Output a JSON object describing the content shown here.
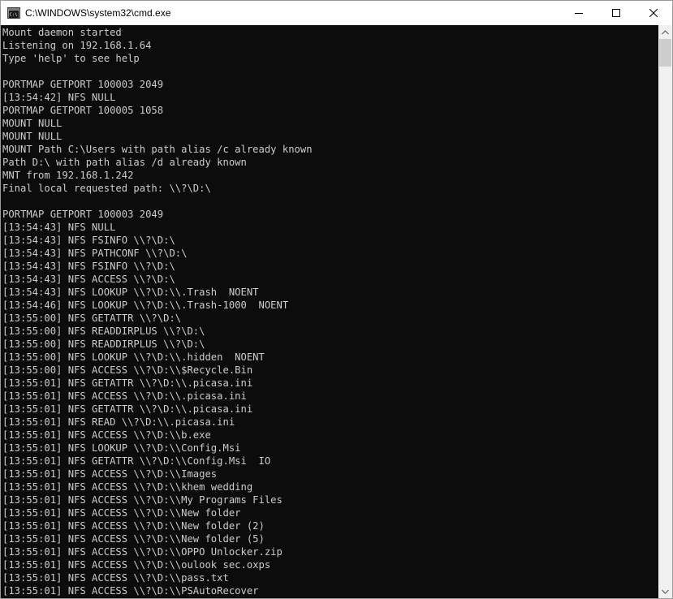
{
  "window": {
    "title": "C:\\WINDOWS\\system32\\cmd.exe"
  },
  "console": {
    "lines": [
      "Mount daemon started",
      "Listening on 192.168.1.64",
      "Type 'help' to see help",
      "",
      "PORTMAP GETPORT 100003 2049",
      "[13:54:42] NFS NULL",
      "PORTMAP GETPORT 100005 1058",
      "MOUNT NULL",
      "MOUNT NULL",
      "MOUNT Path C:\\Users with path alias /c already known",
      "Path D:\\ with path alias /d already known",
      "MNT from 192.168.1.242",
      "Final local requested path: \\\\?\\D:\\",
      "",
      "PORTMAP GETPORT 100003 2049",
      "[13:54:43] NFS NULL",
      "[13:54:43] NFS FSINFO \\\\?\\D:\\",
      "[13:54:43] NFS PATHCONF \\\\?\\D:\\",
      "[13:54:43] NFS FSINFO \\\\?\\D:\\",
      "[13:54:43] NFS ACCESS \\\\?\\D:\\",
      "[13:54:43] NFS LOOKUP \\\\?\\D:\\\\.Trash  NOENT",
      "[13:54:46] NFS LOOKUP \\\\?\\D:\\\\.Trash-1000  NOENT",
      "[13:55:00] NFS GETATTR \\\\?\\D:\\",
      "[13:55:00] NFS READDIRPLUS \\\\?\\D:\\",
      "[13:55:00] NFS READDIRPLUS \\\\?\\D:\\",
      "[13:55:00] NFS LOOKUP \\\\?\\D:\\\\.hidden  NOENT",
      "[13:55:00] NFS ACCESS \\\\?\\D:\\\\$Recycle.Bin",
      "[13:55:01] NFS GETATTR \\\\?\\D:\\\\.picasa.ini",
      "[13:55:01] NFS ACCESS \\\\?\\D:\\\\.picasa.ini",
      "[13:55:01] NFS GETATTR \\\\?\\D:\\\\.picasa.ini",
      "[13:55:01] NFS READ \\\\?\\D:\\\\.picasa.ini",
      "[13:55:01] NFS ACCESS \\\\?\\D:\\\\b.exe",
      "[13:55:01] NFS LOOKUP \\\\?\\D:\\\\Config.Msi",
      "[13:55:01] NFS GETATTR \\\\?\\D:\\\\Config.Msi  IO",
      "[13:55:01] NFS ACCESS \\\\?\\D:\\\\Images",
      "[13:55:01] NFS ACCESS \\\\?\\D:\\\\khem wedding",
      "[13:55:01] NFS ACCESS \\\\?\\D:\\\\My Programs Files",
      "[13:55:01] NFS ACCESS \\\\?\\D:\\\\New folder",
      "[13:55:01] NFS ACCESS \\\\?\\D:\\\\New folder (2)",
      "[13:55:01] NFS ACCESS \\\\?\\D:\\\\New folder (5)",
      "[13:55:01] NFS ACCESS \\\\?\\D:\\\\OPPO Unlocker.zip",
      "[13:55:01] NFS ACCESS \\\\?\\D:\\\\oulook sec.oxps",
      "[13:55:01] NFS ACCESS \\\\?\\D:\\\\pass.txt",
      "[13:55:01] NFS ACCESS \\\\?\\D:\\\\PSAutoRecover"
    ]
  },
  "scrollbar": {
    "position": 0.0,
    "visible_fraction": 0.05
  },
  "colors": {
    "console_background": "#0c0c0c",
    "console_text": "#cccccc",
    "titlebar_background": "#ffffff",
    "scrollbar_track": "#f0f0f0",
    "scrollbar_thumb": "#cdcdcd"
  },
  "icons": {
    "app": "cmd-icon",
    "minimize": "minimize-icon",
    "maximize": "maximize-icon",
    "close": "close-icon",
    "scroll_up": "scroll-up-arrow-icon",
    "scroll_down": "scroll-down-arrow-icon"
  }
}
